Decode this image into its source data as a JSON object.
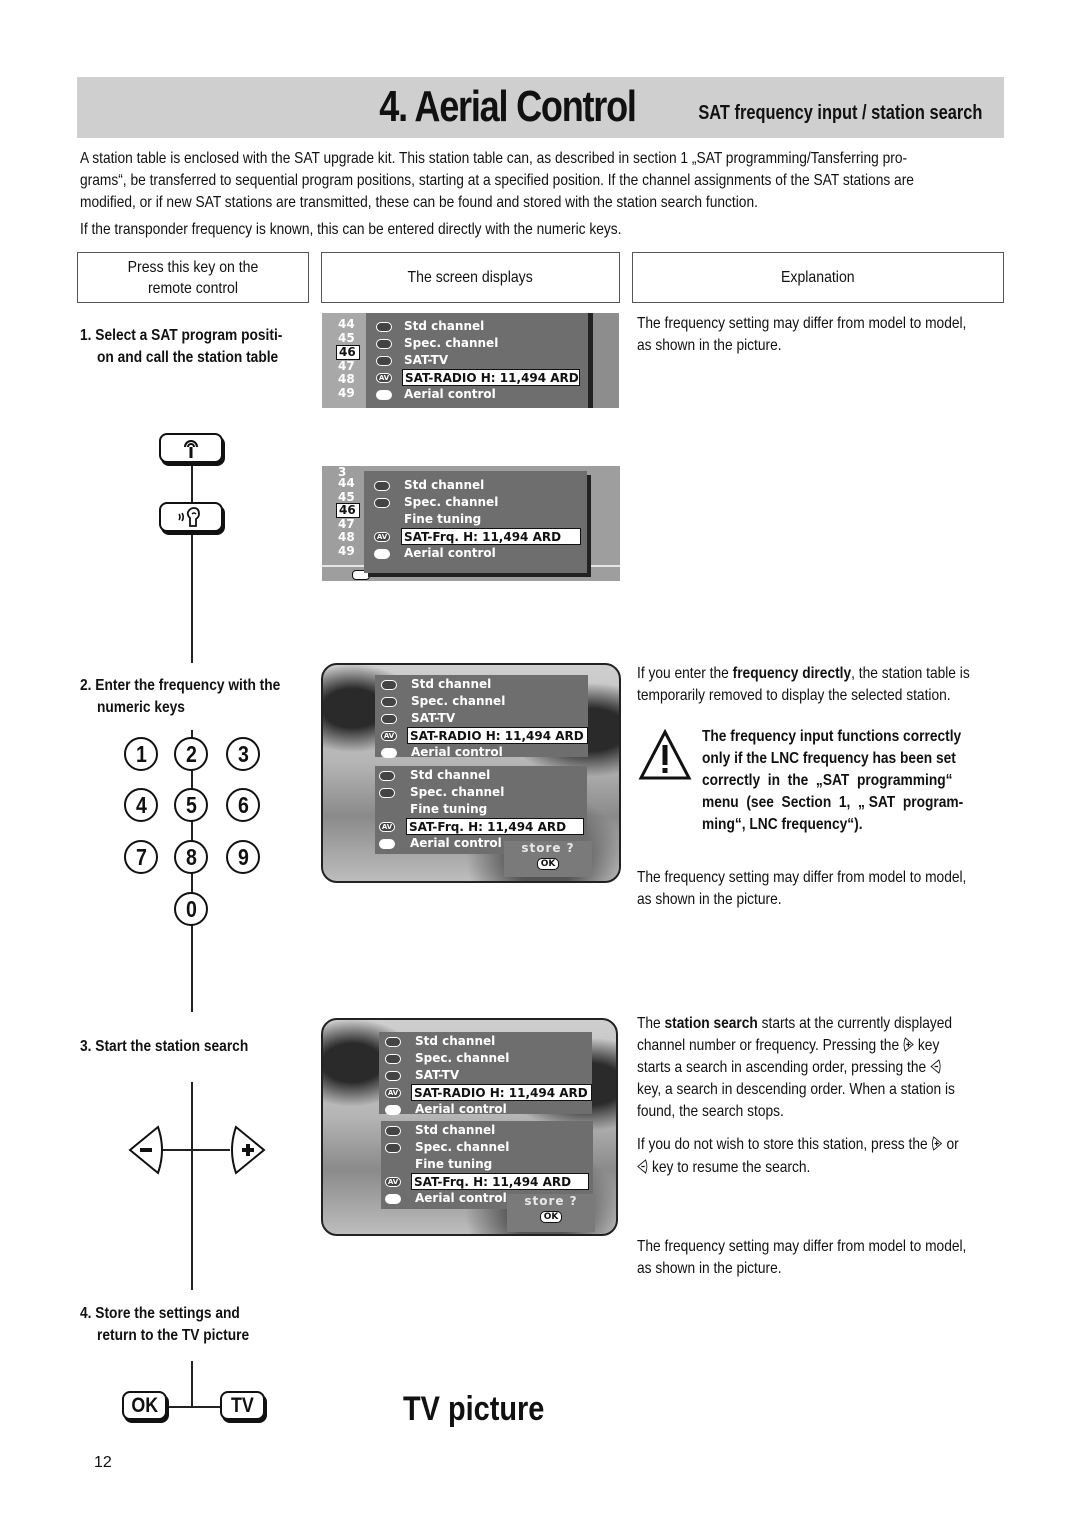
{
  "header": {
    "title": "4. Aerial Control",
    "subtitle": "SAT frequency input / station search",
    "background": "#cfcfcf"
  },
  "intro": {
    "lines": [
      "A station table is enclosed with the SAT upgrade kit. This station table can, as described in section 1 „SAT programming/Tansferring pro-",
      "grams“, be transferred to sequential program positions, starting at a specified position. If the channel assignments of the SAT stations are",
      "modified, or if new SAT stations are transmitted, these can be found and stored with the station search function."
    ],
    "note": "If the transponder frequency is known, this can be entered directly with the numeric keys."
  },
  "columns": {
    "key": "Press this key on the remote control",
    "screen": "The screen displays",
    "explanation": "Explanation"
  },
  "steps": [
    {
      "line1": "1. Select a SAT program positi-",
      "line2": "on and call the station table"
    },
    {
      "line1": "2. Enter the frequency with the",
      "line2": "numeric keys"
    },
    {
      "line1": "3. Start the station search",
      "line2": ""
    },
    {
      "line1": "4. Store the settings and",
      "line2": "return to the TV picture"
    }
  ],
  "keys": {
    "aerial": "aerial-key",
    "ear": "special-channel-key",
    "numbers": [
      "1",
      "2",
      "3",
      "4",
      "5",
      "6",
      "7",
      "8",
      "9",
      "0"
    ],
    "minus": "−",
    "plus": "+",
    "ok": "OK",
    "tv": "TV"
  },
  "screens": {
    "program_numbers": [
      "44",
      "45",
      "46",
      "47",
      "48",
      "49"
    ],
    "selected_program": "46",
    "partial_top_row": "3",
    "menu1": [
      {
        "icon": "std-channel-icon",
        "label": "Std channel"
      },
      {
        "icon": "spec-channel-icon",
        "label": "Spec. channel"
      },
      {
        "icon": "sat-tv-icon",
        "label": "SAT-TV"
      },
      {
        "icon": "av-icon",
        "label": "SAT-RADIO   H: 11,494 ARD",
        "selected": true
      },
      {
        "icon": "aerial-control-icon",
        "label": "Aerial control"
      }
    ],
    "menu2": [
      {
        "icon": "std-channel-icon",
        "label": "Std channel"
      },
      {
        "icon": "spec-channel-icon",
        "label": "Spec. channel"
      },
      {
        "icon": "",
        "label": "Fine tuning"
      },
      {
        "icon": "av-icon",
        "label": "SAT-Frq.      H: 11,494 ARD",
        "selected": true
      },
      {
        "icon": "aerial-control-icon",
        "label": "Aerial control"
      }
    ],
    "store_prompt": "store ?",
    "ok_label": "OK",
    "av_label": "AV"
  },
  "explanations": {
    "e1": [
      "The frequency setting may differ from model to model,",
      "as shown in the picture."
    ],
    "e2_pre": "If you enter the ",
    "e2_bold": "frequency directly",
    "e2_post": ", the station table is",
    "e2_line2": "temporarily removed to display the selected station.",
    "warning": [
      "The frequency input functions correctly",
      "only if the LNC frequency has been set",
      "correctly  in  the  „SAT  programming“",
      "menu  (see  Section  1,  „ SAT  program-",
      "ming“, LNC frequency“)."
    ],
    "e3": [
      "The frequency setting may differ from model to model,",
      "as shown in the picture."
    ],
    "e4_pre": "The ",
    "e4_bold": "station search",
    "e4_post": " starts at the currently displayed",
    "e4_line2a": "channel number or frequency. Pressing the ",
    "e4_line2b": " key",
    "e4_line3a": "starts a search in ascending order, pressing the ",
    "e4_line4": "key, a search in descending order. When a station is",
    "e4_line5": "found, the search stops.",
    "e5_line1a": "If you do not wish to store this station, press the ",
    "e5_line1b": " or",
    "e5_line2": " key to resume the search.",
    "e6": [
      "The frequency setting may differ from model to model,",
      "as shown in the picture."
    ]
  },
  "footer": {
    "tv_picture": "TV picture",
    "page_number": "12"
  }
}
